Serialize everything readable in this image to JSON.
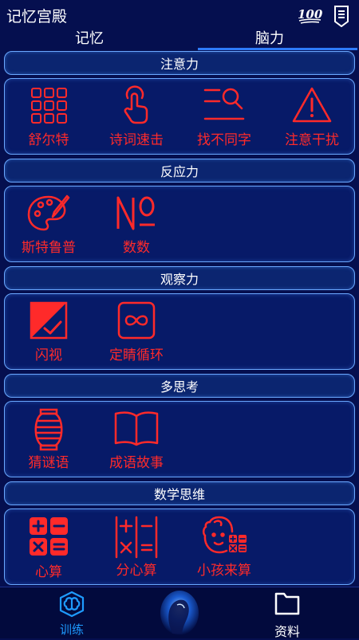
{
  "app_title": "记忆宫殿",
  "tabs": [
    {
      "label": "记忆",
      "selected": false
    },
    {
      "label": "脑力",
      "selected": true
    }
  ],
  "accent_color": "#ff2a2a",
  "sections": [
    {
      "title": "注意力",
      "items": [
        {
          "label": "舒尔特",
          "icon": "grid-icon"
        },
        {
          "label": "诗词速击",
          "icon": "tap-finger-icon"
        },
        {
          "label": "找不同字",
          "icon": "search-lines-icon"
        },
        {
          "label": "注意干扰",
          "icon": "warning-icon"
        }
      ]
    },
    {
      "title": "反应力",
      "items": [
        {
          "label": "斯特鲁普",
          "icon": "palette-icon"
        },
        {
          "label": "数数",
          "icon": "numero-icon"
        }
      ]
    },
    {
      "title": "观察力",
      "items": [
        {
          "label": "闪视",
          "icon": "flash-view-icon"
        },
        {
          "label": "定睛循环",
          "icon": "infinity-icon"
        }
      ]
    },
    {
      "title": "多思考",
      "items": [
        {
          "label": "猜谜语",
          "icon": "lantern-icon"
        },
        {
          "label": "成语故事",
          "icon": "book-icon"
        }
      ]
    },
    {
      "title": "数学思维",
      "items": [
        {
          "label": "心算",
          "icon": "calculator-icon"
        },
        {
          "label": "分心算",
          "icon": "math-symbols-icon"
        },
        {
          "label": "小孩来算",
          "icon": "child-math-icon"
        }
      ]
    }
  ],
  "bottom_nav": {
    "train": {
      "label": "训练",
      "icon": "brain-icon",
      "selected": true
    },
    "data": {
      "label": "资料",
      "icon": "folder-icon"
    }
  },
  "status_icons": {
    "hundred": "100",
    "note": "note-icon"
  }
}
